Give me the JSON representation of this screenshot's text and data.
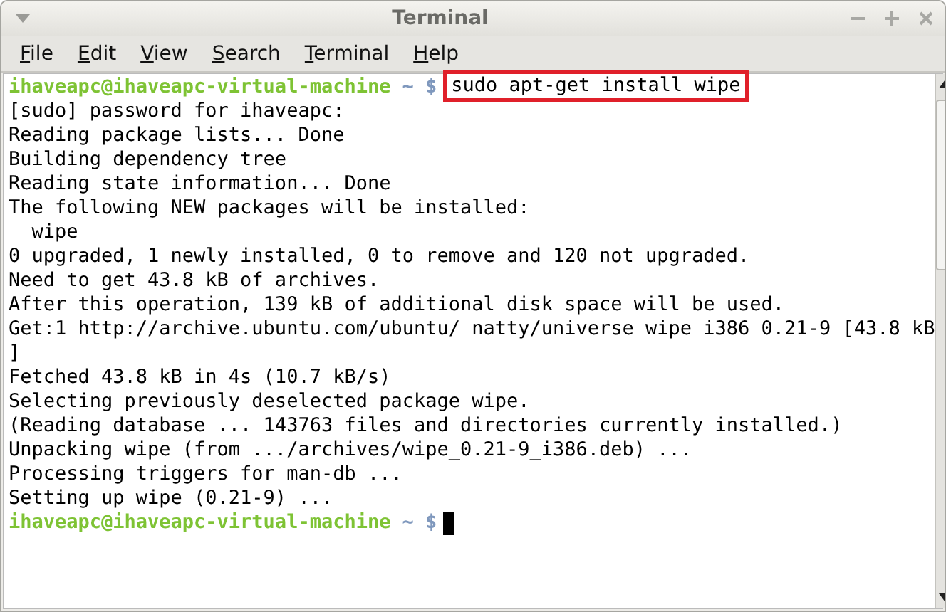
{
  "window": {
    "title": "Terminal"
  },
  "menu": [
    "File",
    "Edit",
    "View",
    "Search",
    "Terminal",
    "Help"
  ],
  "terminal": {
    "lines": [
      {
        "kind": "prompt",
        "user_host": "ihaveapc@ihaveapc-virtual-machine",
        "path": "~ $",
        "command": "sudo apt-get install wipe",
        "highlighted": true
      },
      {
        "kind": "output",
        "text": "[sudo] password for ihaveapc:"
      },
      {
        "kind": "output",
        "text": "Reading package lists... Done"
      },
      {
        "kind": "output",
        "text": "Building dependency tree"
      },
      {
        "kind": "output",
        "text": "Reading state information... Done"
      },
      {
        "kind": "output",
        "text": "The following NEW packages will be installed:"
      },
      {
        "kind": "output",
        "text": "  wipe"
      },
      {
        "kind": "output",
        "text": "0 upgraded, 1 newly installed, 0 to remove and 120 not upgraded."
      },
      {
        "kind": "output",
        "text": "Need to get 43.8 kB of archives."
      },
      {
        "kind": "output",
        "text": "After this operation, 139 kB of additional disk space will be used."
      },
      {
        "kind": "output",
        "text": "Get:1 http://archive.ubuntu.com/ubuntu/ natty/universe wipe i386 0.21-9 [43.8 kB"
      },
      {
        "kind": "output",
        "text": "]"
      },
      {
        "kind": "output",
        "text": "Fetched 43.8 kB in 4s (10.7 kB/s)"
      },
      {
        "kind": "output",
        "text": "Selecting previously deselected package wipe."
      },
      {
        "kind": "output",
        "text": "(Reading database ... 143763 files and directories currently installed.)"
      },
      {
        "kind": "output",
        "text": "Unpacking wipe (from .../archives/wipe_0.21-9_i386.deb) ..."
      },
      {
        "kind": "output",
        "text": "Processing triggers for man-db ..."
      },
      {
        "kind": "output",
        "text": "Setting up wipe (0.21-9) ..."
      },
      {
        "kind": "prompt",
        "user_host": "ihaveapc@ihaveapc-virtual-machine",
        "path": "~ $",
        "cursor": true
      }
    ]
  }
}
